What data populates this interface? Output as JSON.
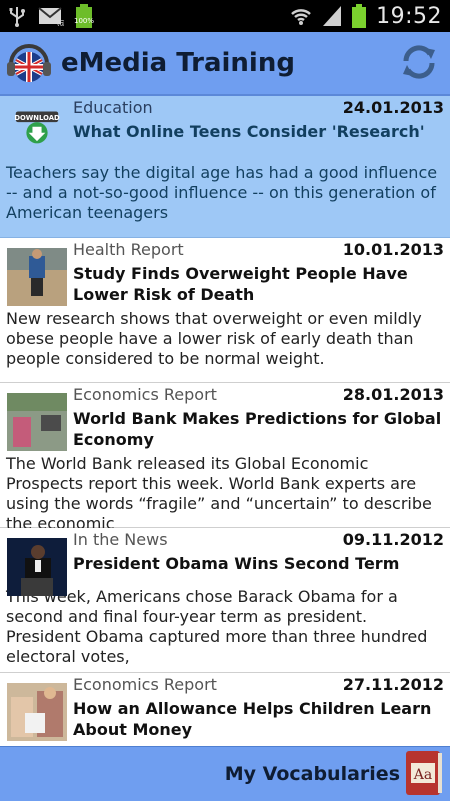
{
  "status": {
    "time": "19:52",
    "battery_label": "100%",
    "icons": [
      "usb-icon",
      "email-icon",
      "battery-icon",
      "wifi-icon",
      "signal-icon"
    ]
  },
  "app": {
    "title": "eMedia Training",
    "refresh_icon": "refresh-icon",
    "accent": "#6f9ef0"
  },
  "articles": [
    {
      "category": "Education",
      "date": "24.01.2013",
      "title": "What Online Teens Consider 'Research'",
      "summary": "Teachers say the digital age has had a good influence -- and a not-so-good influence -- on this generation of American teenagers",
      "thumb_label": "DOWNLOAD",
      "selected": true
    },
    {
      "category": "Health Report",
      "date": "10.01.2013",
      "title": "Study Finds Overweight People Have Lower Risk of Death",
      "summary": "New research shows that overweight or even mildly obese people have a lower risk of early death than people considered to be normal weight."
    },
    {
      "category": "Economics Report",
      "date": "28.01.2013",
      "title": "World Bank Makes Predictions for Global Economy",
      "summary": "The World Bank released its Global Economic Prospects report this week. World Bank experts are using the words “fragile” and “uncertain” to describe the economic"
    },
    {
      "category": "In the News",
      "date": "09.11.2012",
      "title": "President Obama Wins Second Term",
      "summary": "This week, Americans chose Barack Obama for a second and final four-year term as president. President Obama captured more than three hundred electoral votes,"
    },
    {
      "category": "Economics Report",
      "date": "27.11.2012",
      "title": "How an Allowance Helps Children Learn About Money",
      "summary": ""
    }
  ],
  "bottom": {
    "label": "My Vocabularies",
    "book_text": "Aa"
  }
}
